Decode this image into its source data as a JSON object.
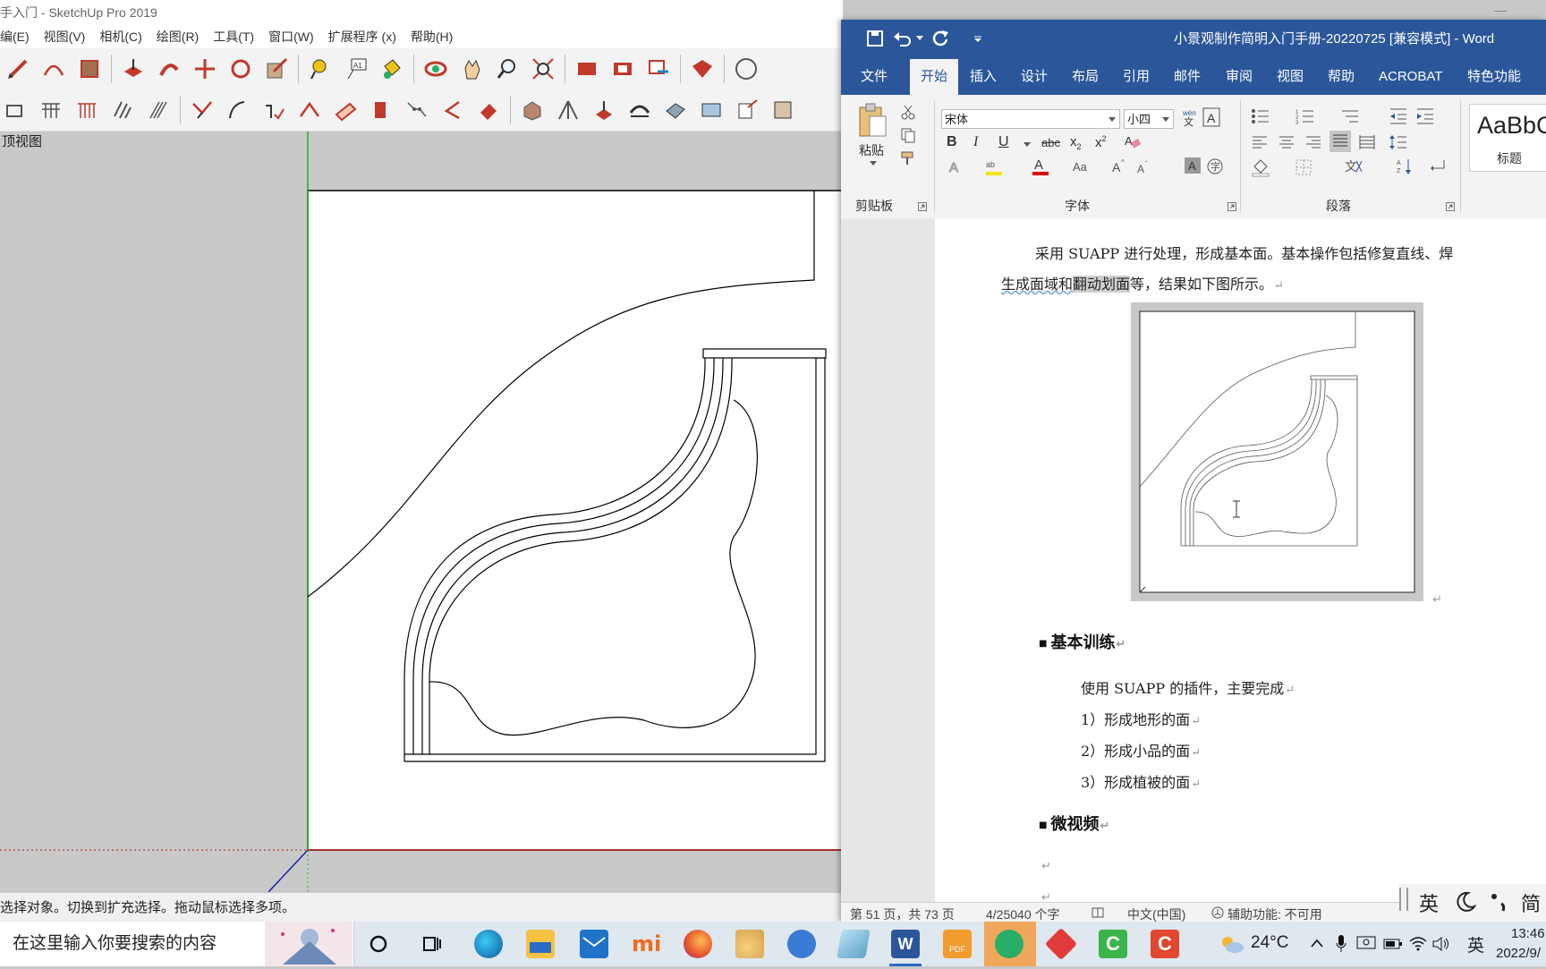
{
  "sketchup": {
    "title": "手入门 - SketchUp Pro 2019",
    "menu": [
      "编(E)",
      "视图(V)",
      "相机(C)",
      "绘图(R)",
      "工具(T)",
      "窗口(W)",
      "扩展程序 (x)",
      "帮助(H)"
    ],
    "view_label": "顶视图",
    "status": "选择对象。切换到扩充选择。拖动鼠标选择多项。"
  },
  "word": {
    "title": "小景观制作简明入门手册-20220725 [兼容模式]  -  Word",
    "tabs": [
      "文件",
      "开始",
      "插入",
      "设计",
      "布局",
      "引用",
      "邮件",
      "审阅",
      "视图",
      "帮助",
      "ACROBAT",
      "特色功能"
    ],
    "active_tab": "开始",
    "ribbon": {
      "paste_label": "粘贴",
      "clipboard_label": "剪贴板",
      "font_name": "宋体",
      "font_size": "小四",
      "font_group_label": "字体",
      "paragraph_group_label": "段落",
      "style_preview": "AaBbC",
      "style_name": "标题"
    },
    "doc": {
      "para1_line1": "采用 SUAPP 进行处理，形成基本面。基本操作包括修复直线、焊",
      "para1_line2_a": "生成面域和",
      "para1_line2_b": "翻动划面",
      "para1_line2_c": "等，结果如下图所示。",
      "heading1": "基本训练",
      "line_intro": "使用 SUAPP 的插件，主要完成",
      "item1": "1）形成地形的面",
      "item2": "2）形成小品的面",
      "item3": "3）形成植被的面",
      "heading2": "微视频"
    },
    "status": {
      "page": "第 51 页，共 73 页",
      "words": "4/25040 个字",
      "language": "中文(中国)",
      "accessibility": "辅助功能: 不可用"
    }
  },
  "ime": {
    "lang": "英",
    "mode": "简"
  },
  "taskbar": {
    "search_placeholder": "在这里输入你要搜索的内容",
    "weather": "24°C",
    "tray_lang": "英",
    "time": "13:46",
    "date": "2022/9/"
  }
}
